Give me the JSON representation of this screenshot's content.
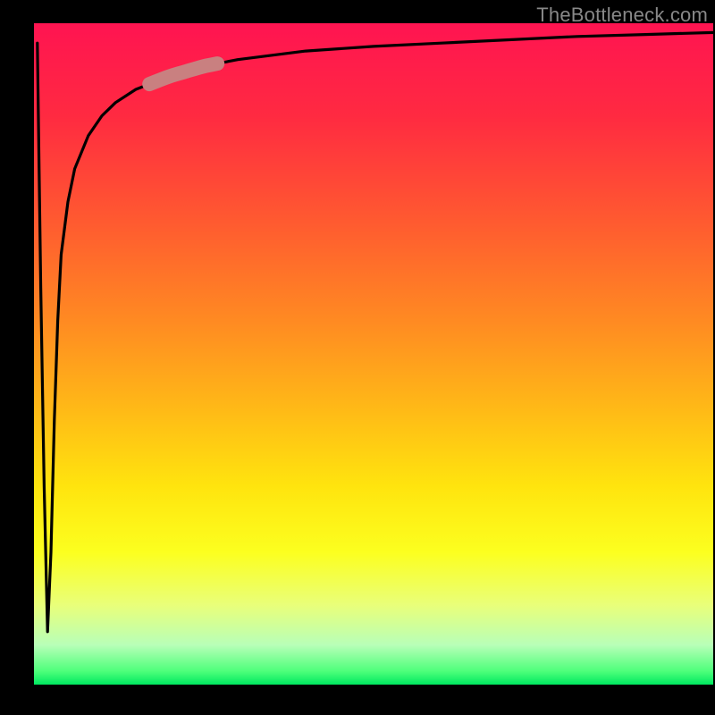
{
  "watermark": "TheBottleneck.com",
  "chart_data": {
    "type": "line",
    "title": "",
    "xlabel": "",
    "ylabel": "",
    "xlim": [
      0,
      100
    ],
    "ylim": [
      0,
      100
    ],
    "gradient_meaning": "red (top) = high bottleneck, green (bottom) = no bottleneck",
    "series": [
      {
        "name": "bottleneck-curve",
        "x": [
          0.5,
          1.0,
          1.5,
          2.0,
          2.5,
          3.0,
          3.5,
          4.0,
          5,
          6,
          8,
          10,
          12,
          15,
          20,
          25,
          30,
          40,
          50,
          60,
          70,
          80,
          90,
          100
        ],
        "y": [
          97,
          60,
          30,
          8,
          20,
          40,
          55,
          65,
          73,
          78,
          83,
          86,
          88,
          90,
          92,
          93.5,
          94.5,
          95.8,
          96.5,
          97,
          97.5,
          98,
          98.3,
          98.6
        ]
      }
    ],
    "highlight_segment": {
      "name": "user-range-marker",
      "x_start": 17,
      "x_end": 27,
      "color": "#c98080"
    }
  }
}
